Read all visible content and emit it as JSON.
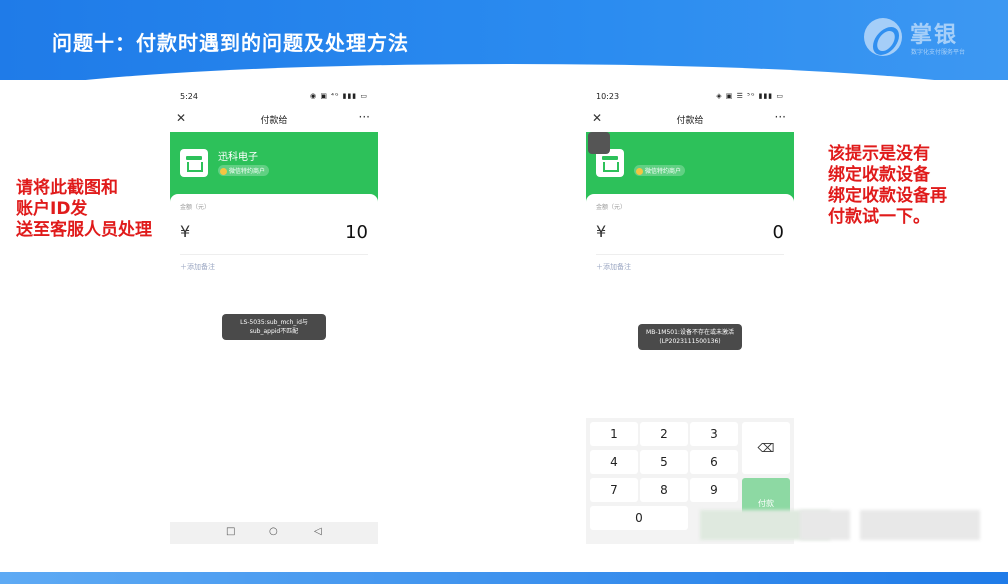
{
  "slide": {
    "title": "问题十：付款时遇到的问题及处理方法",
    "logo_text": "掌银",
    "logo_sub": "数字化支付服务平台",
    "annotation_left": [
      "请将此截图和",
      "账户ID发",
      "送至客服人员处理"
    ],
    "annotation_right": [
      "该提示是没有",
      "绑定收款设备",
      "绑定收款设备再",
      "付款试一下。"
    ]
  },
  "phone1": {
    "time": "5:24",
    "status_icons": "◉ ▣ ⁴ᴳ ▮▮▮ ▭",
    "nav_close": "✕",
    "nav_title": "付款给",
    "nav_more": "···",
    "merchant_name": "迅科电子",
    "merchant_badge": "微信特约商户",
    "amount_label": "金额（元）",
    "currency": "¥",
    "amount": "10",
    "add_note": "＋添加备注",
    "toast": "LS-5035:sub_mch_id与sub_appid不匹配",
    "sys_nav": {
      "square": "□",
      "circle": "○",
      "back": "◁"
    }
  },
  "phone2": {
    "time": "10:23",
    "status_icons": "◈ ▣ ☰ ⁵ᴳ ▮▮▮ ▭",
    "nav_close": "✕",
    "nav_title": "付款给",
    "nav_more": "···",
    "merchant_badge": "微信特约商户",
    "amount_label": "金额（元）",
    "currency": "¥",
    "amount": "0",
    "add_note": "＋添加备注",
    "toast": "MB-1M501:设备不存在或未激活(LP2023111500136)",
    "keys": [
      "1",
      "2",
      "3",
      "4",
      "5",
      "6",
      "7",
      "8",
      "9",
      "0"
    ],
    "delete_key": "⌫",
    "pay_key": "付款"
  }
}
